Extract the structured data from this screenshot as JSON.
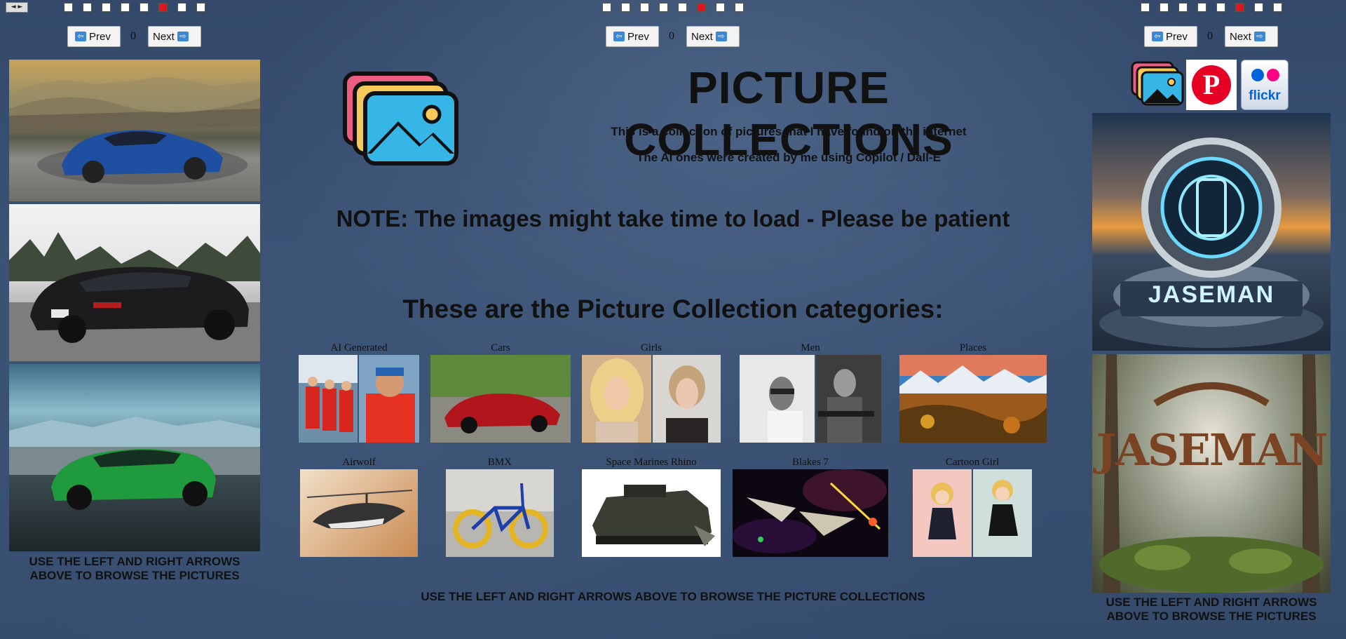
{
  "window": {
    "toggle_label": "◄ ►"
  },
  "nav": {
    "prev_label": "Prev",
    "next_label": "Next",
    "left_count": "0",
    "center_count": "0",
    "right_count": "0"
  },
  "header": {
    "title": "PICTURE COLLECTIONS",
    "subtitle1": "This is a collection of pictures that I have found on the internet",
    "subtitle2": "The AI ones were created by me using Copilot / Dall-E",
    "note": "NOTE: The images might take time to load - Please be patient",
    "categories_heading": "These are the Picture Collection categories:"
  },
  "categories": [
    {
      "label": "AI Generated"
    },
    {
      "label": "Cars"
    },
    {
      "label": "Girls"
    },
    {
      "label": "Men"
    },
    {
      "label": "Places"
    },
    {
      "label": "Airwolf"
    },
    {
      "label": "BMX"
    },
    {
      "label": "Space Marines Rhino"
    },
    {
      "label": "Blakes 7"
    },
    {
      "label": "Cartoon Girl"
    }
  ],
  "footer": {
    "left_hint": "USE THE LEFT AND RIGHT ARROWS ABOVE TO BROWSE THE PICTURES",
    "center_hint": "USE THE LEFT AND RIGHT ARROWS ABOVE TO BROWSE THE PICTURE COLLECTIONS",
    "right_hint": "USE THE LEFT AND RIGHT ARROWS ABOVE TO BROWSE THE PICTURES"
  },
  "social": {
    "flickr_label": "flickr",
    "pinterest_label": "P"
  },
  "images": {
    "jaseman_sign": "JASEMAN",
    "jaseman_wood": "JASEMAN"
  },
  "colors": {
    "accent_red": "#e0161c",
    "button_arrow": "#3a88d8"
  }
}
